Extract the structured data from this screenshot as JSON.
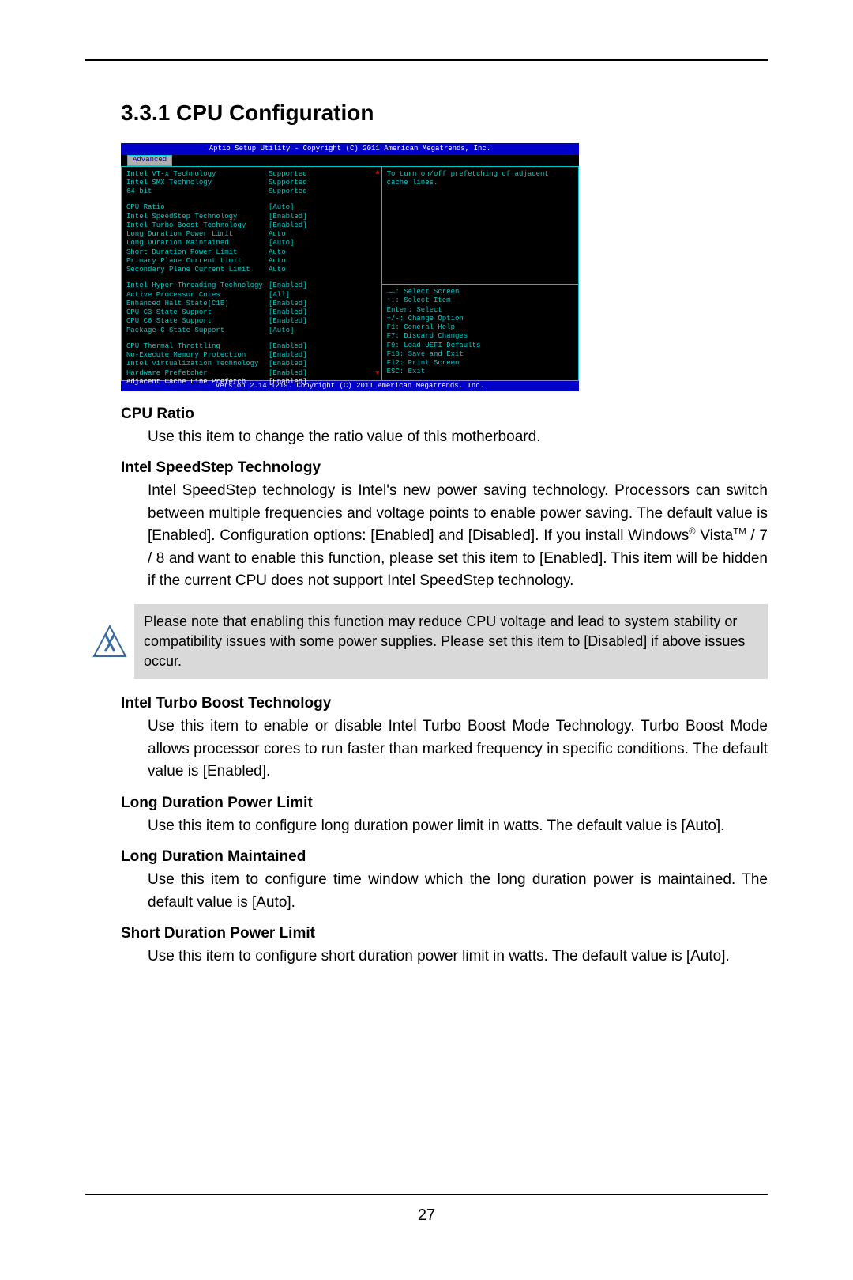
{
  "section": {
    "heading": "3.3.1  CPU Configuration"
  },
  "bios": {
    "titlebar": "Aptio Setup Utility - Copyright (C) 2011 American Megatrends, Inc.",
    "tab": "Advanced",
    "footer": "Version 2.14.1219. Copyright (C) 2011 American Megatrends, Inc.",
    "rows_a": [
      {
        "label": "Intel VT-x Technology",
        "value": "Supported",
        "hi": false
      },
      {
        "label": "Intel SMX Technology",
        "value": "Supported",
        "hi": false
      },
      {
        "label": "64-bit",
        "value": "Supported",
        "hi": false
      }
    ],
    "rows_b": [
      {
        "label": "CPU Ratio",
        "value": "[Auto]",
        "hi": false
      },
      {
        "label": "Intel SpeedStep Technology",
        "value": "[Enabled]",
        "hi": false
      },
      {
        "label": "Intel Turbo Boost Technology",
        "value": "[Enabled]",
        "hi": false
      },
      {
        "label": "Long Duration Power Limit",
        "value": "Auto",
        "hi": false
      },
      {
        "label": "Long Duration Maintained",
        "value": "[Auto]",
        "hi": false
      },
      {
        "label": "Short Duration Power Limit",
        "value": "Auto",
        "hi": false
      },
      {
        "label": "Primary Plane Current Limit",
        "value": "Auto",
        "hi": false
      },
      {
        "label": "Secondary Plane Current Limit",
        "value": "Auto",
        "hi": false
      }
    ],
    "rows_c": [
      {
        "label": "Intel Hyper Threading Technology",
        "value": "[Enabled]",
        "hi": false
      },
      {
        "label": "Active Processor Cores",
        "value": "[All]",
        "hi": false
      },
      {
        "label": "Enhanced Halt State(C1E)",
        "value": "[Enabled]",
        "hi": false
      },
      {
        "label": "CPU C3 State Support",
        "value": "[Enabled]",
        "hi": false
      },
      {
        "label": "CPU C6 State Support",
        "value": "[Enabled]",
        "hi": false
      },
      {
        "label": "Package C State Support",
        "value": "[Auto]",
        "hi": false
      }
    ],
    "rows_d": [
      {
        "label": "CPU Thermal Throttling",
        "value": "[Enabled]",
        "hi": false
      },
      {
        "label": "No-Execute Memory Protection",
        "value": "[Enabled]",
        "hi": false
      },
      {
        "label": "Intel Virtualization Technology",
        "value": "[Enabled]",
        "hi": false
      },
      {
        "label": "Hardware Prefetcher",
        "value": "[Enabled]",
        "hi": false
      },
      {
        "label": "Adjacent Cache Line Prefetch",
        "value": "[Enabled]",
        "hi": true
      }
    ],
    "help_top": "To turn on/off prefetching of adjacent cache lines.",
    "help_nav": "→←: Select Screen\n↑↓: Select Item\nEnter: Select\n+/-: Change Option\nF1: General Help\nF7: Discard Changes\nF9: Load UEFI Defaults\nF10: Save and Exit\nF12: Print Screen\nESC: Exit"
  },
  "descriptions": [
    {
      "title": "CPU Ratio",
      "body": "Use this item to change the ratio value of this motherboard."
    },
    {
      "title": "Intel SpeedStep Technology",
      "body_html": "Intel SpeedStep technology is Intel's new power saving technology. Processors can switch between multiple frequencies and voltage points to enable power saving. The default value is [Enabled]. Configuration options: [Enabled] and [Disabled]. If you install Windows<sup>®</sup> Vista<sup>TM</sup> / 7 / 8 and want to enable this function, please set this item to [Enabled]. This item will be hidden if the current CPU does not support Intel SpeedStep technology."
    }
  ],
  "note": "Please note that enabling this function may reduce CPU voltage and lead to system stability or compatibility issues with some power supplies. Please set this item to [Disabled] if above issues occur.",
  "descriptions2": [
    {
      "title": "Intel Turbo Boost Technology",
      "body": "Use this item to enable or disable Intel Turbo Boost Mode Technology. Turbo Boost Mode allows processor cores to run faster than marked frequency in specific conditions. The default value is [Enabled]."
    },
    {
      "title": "Long Duration Power Limit",
      "body": "Use this item to configure long duration power limit in watts. The default value is [Auto]."
    },
    {
      "title": "Long Duration Maintained",
      "body": "Use this item to configure time window which the long duration power is maintained. The default value is [Auto]."
    },
    {
      "title": "Short Duration Power Limit",
      "body": "Use this item to configure short duration power limit in watts. The default value is [Auto]."
    }
  ],
  "page_number": "27"
}
